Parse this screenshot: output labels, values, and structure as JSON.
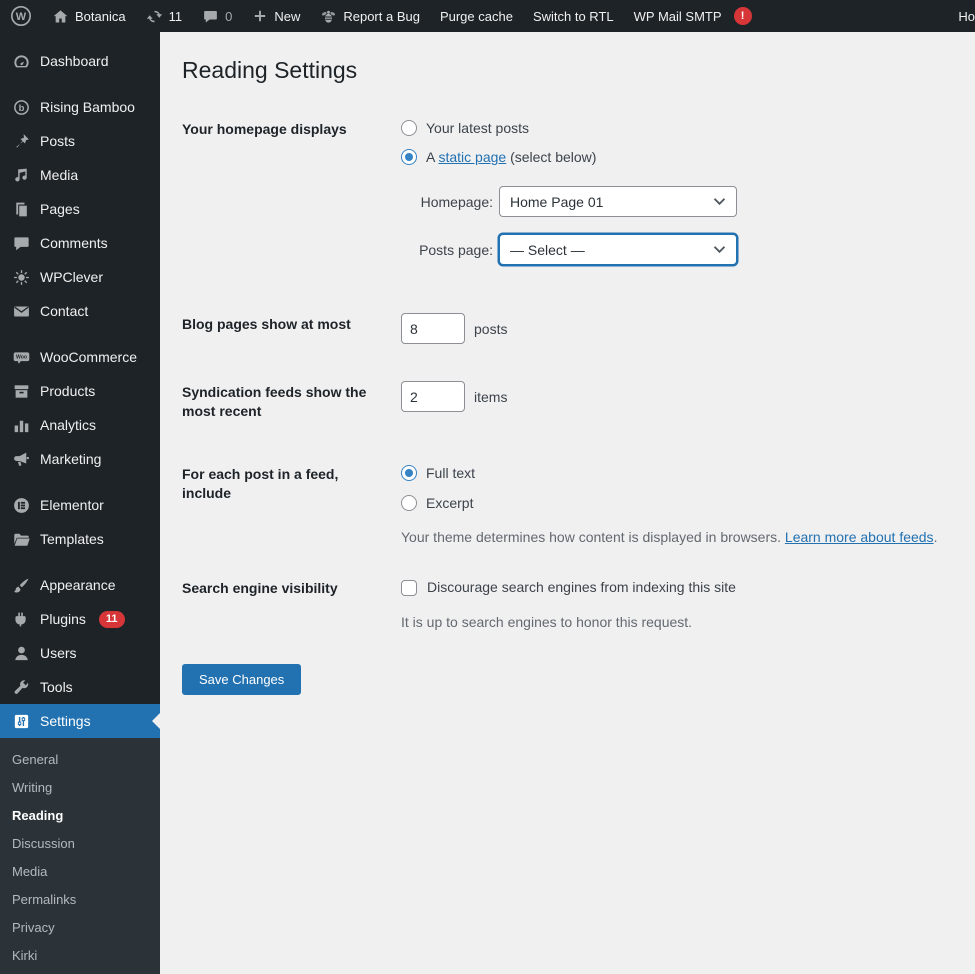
{
  "admin_bar": {
    "site_name": "Botanica",
    "update_count": "11",
    "comment_count": "0",
    "new_label": "New",
    "report_bug_label": "Report a Bug",
    "purge_cache_label": "Purge cache",
    "rtl_label": "Switch to RTL",
    "smtp_label": "WP Mail SMTP",
    "smtp_badge": "!",
    "howdy_text": "Ho"
  },
  "sidebar": {
    "items": [
      {
        "label": "Dashboard"
      },
      {
        "label": "Rising Bamboo"
      },
      {
        "label": "Posts"
      },
      {
        "label": "Media"
      },
      {
        "label": "Pages"
      },
      {
        "label": "Comments"
      },
      {
        "label": "WPClever"
      },
      {
        "label": "Contact"
      },
      {
        "label": "WooCommerce"
      },
      {
        "label": "Products"
      },
      {
        "label": "Analytics"
      },
      {
        "label": "Marketing"
      },
      {
        "label": "Elementor"
      },
      {
        "label": "Templates"
      },
      {
        "label": "Appearance"
      },
      {
        "label": "Plugins",
        "badge": "11"
      },
      {
        "label": "Users"
      },
      {
        "label": "Tools"
      },
      {
        "label": "Settings",
        "active": true
      }
    ],
    "submenu": [
      {
        "label": "General"
      },
      {
        "label": "Writing"
      },
      {
        "label": "Reading",
        "current": true
      },
      {
        "label": "Discussion"
      },
      {
        "label": "Media"
      },
      {
        "label": "Permalinks"
      },
      {
        "label": "Privacy"
      },
      {
        "label": "Kirki"
      }
    ]
  },
  "main": {
    "title": "Reading Settings",
    "homepage": {
      "label": "Your homepage displays",
      "option_latest": "Your latest posts",
      "static_prefix": "A ",
      "static_link": "static page",
      "static_suffix": " (select below)",
      "homepage_label": "Homepage:",
      "homepage_value": "Home Page 01",
      "posts_page_label": "Posts page:",
      "posts_page_value": "— Select —"
    },
    "blog_pages": {
      "label": "Blog pages show at most",
      "value": "8",
      "suffix": "posts"
    },
    "syndication": {
      "label": "Syndication feeds show the most recent",
      "value": "2",
      "suffix": "items"
    },
    "feed_include": {
      "label": "For each post in a feed, include",
      "option_full": "Full text",
      "option_excerpt": "Excerpt",
      "description": "Your theme determines how content is displayed in browsers. ",
      "description_link": "Learn more about feeds",
      "description_period": "."
    },
    "search_visibility": {
      "label": "Search engine visibility",
      "checkbox_label": "Discourage search engines from indexing this site",
      "description": "It is up to search engines to honor this request."
    },
    "save_button": "Save Changes"
  },
  "colors": {
    "admin_bar_bg": "#1d2327",
    "sidebar_bg": "#1d2327",
    "submenu_bg": "#2c3338",
    "active_item_bg": "#2271b1",
    "badge_red": "#d63638",
    "content_bg": "#f0f0f1",
    "link": "#2271b1",
    "button_primary_bg": "#2271b1"
  }
}
